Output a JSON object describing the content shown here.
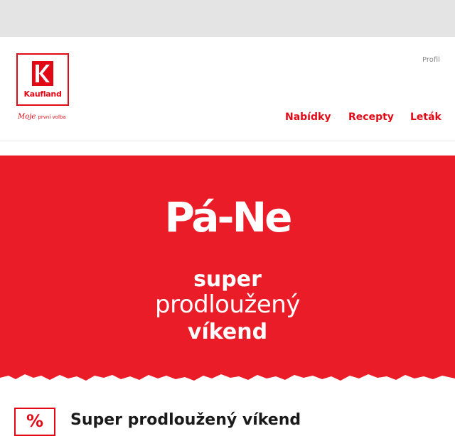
{
  "header": {
    "logo_text": "Kaufland",
    "tagline_main": "Moje",
    "tagline_small": "první volba",
    "profile_label": "Profil",
    "nav": [
      {
        "label": "Nabídky"
      },
      {
        "label": "Recepty"
      },
      {
        "label": "Leták"
      }
    ]
  },
  "hero": {
    "title": "Pá-Ne",
    "line1": "super",
    "line2": "prodloužený",
    "line3": "víkend"
  },
  "promo": {
    "badge": "%",
    "title": "Super prodloužený víkend"
  },
  "colors": {
    "brand_red": "#e10915",
    "hero_red": "#ea1c28",
    "topbar_gray": "#e4e4e4"
  }
}
